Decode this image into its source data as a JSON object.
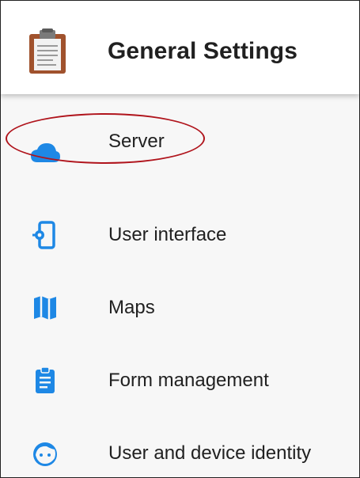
{
  "header": {
    "title": "General Settings",
    "icon": "clipboard-icon"
  },
  "colors": {
    "accent": "#1e88e5",
    "highlight": "#b0141c"
  },
  "menu": {
    "items": [
      {
        "label": "Server",
        "icon": "cloud-icon"
      },
      {
        "label": "User interface",
        "icon": "phone-settings-icon"
      },
      {
        "label": "Maps",
        "icon": "map-icon"
      },
      {
        "label": "Form management",
        "icon": "clipboard-list-icon"
      },
      {
        "label": "User and device identity",
        "icon": "face-icon"
      }
    ]
  }
}
